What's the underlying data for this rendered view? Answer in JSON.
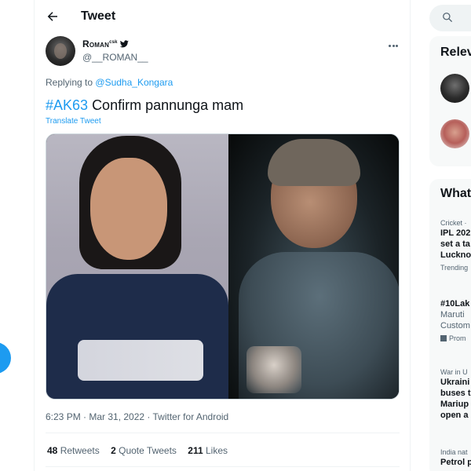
{
  "header": {
    "title": "Tweet"
  },
  "tweet": {
    "display_name": "Roman",
    "display_name_super": "csk",
    "handle": "@__ROMAN__",
    "reply_prefix": "Replying to",
    "reply_mention": "@Sudha_Kongara",
    "hashtag": "#AK63",
    "text": "Confirm pannunga mam",
    "translate_label": "Translate Tweet",
    "timestamp": "6:23 PM · Mar 31, 2022 · Twitter for Android",
    "stats": {
      "retweets_count": "48",
      "retweets_label": "Retweets",
      "quotes_count": "2",
      "quotes_label": "Quote Tweets",
      "likes_count": "211",
      "likes_label": "Likes"
    }
  },
  "sidebar": {
    "relevant_title": "Relev",
    "whats_happening_title": "What",
    "trends": [
      {
        "meta": "Cricket ·",
        "lines": [
          "IPL 202",
          "set a ta",
          "Luckno"
        ],
        "foot": "Trending"
      },
      {
        "meta": "",
        "lines": [
          "#10Lak"
        ],
        "sub": [
          "Maruti",
          "Custom"
        ],
        "foot": "Prom"
      },
      {
        "meta": "War in U",
        "lines": [
          "Ukraini",
          "buses t",
          "Mariup",
          "open a"
        ],
        "foot": ""
      },
      {
        "meta": "India nat",
        "lines": [
          "Petrol p"
        ],
        "foot": ""
      }
    ]
  },
  "icons": {
    "back": "arrow-left-icon",
    "more": "more-horizontal-icon",
    "search": "search-icon",
    "verified_bird": "bird-icon",
    "promoted": "promoted-arrow-icon"
  },
  "colors": {
    "accent": "#1d9bf0",
    "text": "#0f1419",
    "muted": "#536471"
  }
}
